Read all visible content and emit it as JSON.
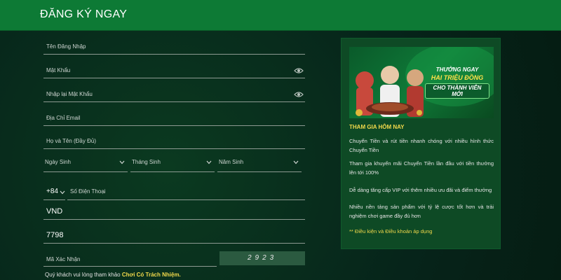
{
  "header": {
    "title": "ĐĂNG KÝ NGAY"
  },
  "form": {
    "username_label": "Tên Đăng Nhập",
    "password_label": "Mật Khẩu",
    "confirm_password_label": "Nhập lại Mật Khẩu",
    "email_label": "Địa Chỉ Email",
    "fullname_label": "Họ và Tên (Đầy Đủ)",
    "birth_day_label": "Ngày Sinh",
    "birth_month_label": "Tháng Sinh",
    "birth_year_label": "Năm Sinh",
    "phone_prefix": "+84",
    "phone_label": "Số Điện Thoại",
    "currency_value": "VND",
    "code_value": "7798",
    "captcha_label": "Mã Xác Nhận",
    "captcha_code": "2923",
    "footnote_text": "Quý khách vui lòng tham khảo",
    "footnote_link": "Chơi Có Trách Nhiệm."
  },
  "promo": {
    "banner_line1": "THƯỞNG NGAY",
    "banner_line2": "HAI TRIỆU ĐỒNG",
    "banner_line3": "CHO THÀNH VIÊN MỚI",
    "title": "THAM GIA HÔM NAY",
    "items": [
      "Chuyển Tiền và rút tiền nhanh chóng với nhiều hình thức Chuyển Tiền",
      "Tham gia khuyến mãi Chuyển Tiền lần đầu với tiền thưởng lên tới 100%",
      "Dễ dàng tăng cấp VIP với thêm nhiều ưu đãi và điểm thưởng",
      "Nhiều nền tảng sản phẩm với tỷ lệ cược tốt hơn và trải nghiệm chơi game đầy đủ hơn"
    ],
    "terms": "** Điều kiện và Điều khoản áp dụng"
  },
  "colors": {
    "header": "#0d7a35",
    "accent": "#f2d94b",
    "panel": "#0e4a25"
  },
  "icons": [
    "eye-icon",
    "chevron-down-icon"
  ]
}
